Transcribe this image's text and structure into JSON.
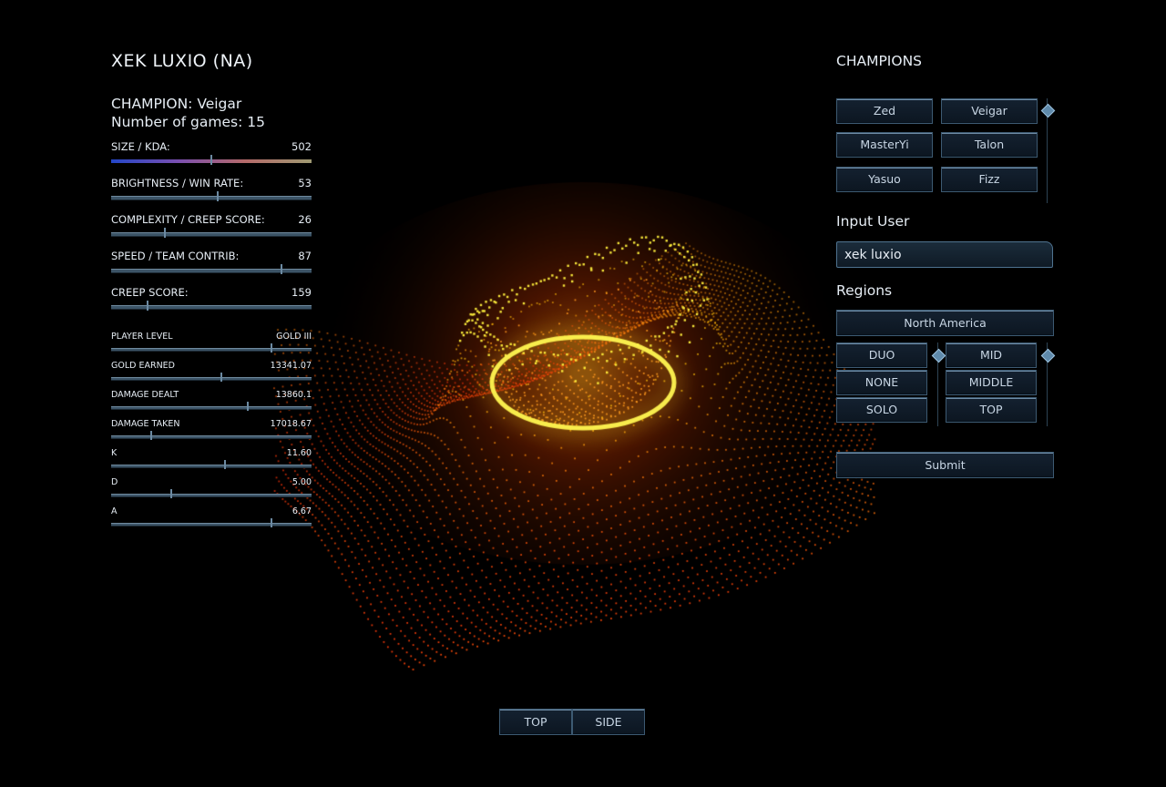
{
  "player": {
    "title": "XEK LUXIO (NA)"
  },
  "champion_info": {
    "champion_line": "CHAMPION: Veigar",
    "games_line": "Number of games: 15"
  },
  "primary_stats": [
    {
      "label": "SIZE / KDA:",
      "value": "502",
      "slider": 0.5
    },
    {
      "label": "BRIGHTNESS / WIN RATE:",
      "value": "53",
      "slider": 0.53
    },
    {
      "label": "COMPLEXITY / CREEP SCORE:",
      "value": "26",
      "slider": 0.27
    },
    {
      "label": "SPEED / TEAM CONTRIB:",
      "value": "87",
      "slider": 0.85
    },
    {
      "label": "CREEP SCORE:",
      "value": "159",
      "slider": 0.18
    }
  ],
  "detail_stats": [
    {
      "label": "PLAYER LEVEL",
      "value": "GOLD III",
      "slider": 0.8
    },
    {
      "label": "GOLD EARNED",
      "value": "13341.07",
      "slider": 0.55
    },
    {
      "label": "DAMAGE DEALT",
      "value": "13860.1",
      "slider": 0.68
    },
    {
      "label": "DAMAGE TAKEN",
      "value": "17018.67",
      "slider": 0.2
    },
    {
      "label": "K",
      "value": "11.60",
      "slider": 0.57
    },
    {
      "label": "D",
      "value": "5.00",
      "slider": 0.3
    },
    {
      "label": "A",
      "value": "6.67",
      "slider": 0.8
    }
  ],
  "champions": {
    "heading": "CHAMPIONS",
    "list": [
      "Zed",
      "Veigar",
      "MasterYi",
      "Talon",
      "Yasuo",
      "Fizz"
    ]
  },
  "input_user": {
    "heading": "Input User",
    "value": "xek luxio"
  },
  "regions": {
    "heading": "Regions",
    "selected": "North America",
    "roles": [
      "DUO",
      "NONE",
      "SOLO"
    ],
    "lanes": [
      "MID",
      "MIDDLE",
      "TOP"
    ]
  },
  "submit_label": "Submit",
  "views": {
    "top_label": "TOP",
    "side_label": "SIDE"
  },
  "colors": {
    "accent": "#3d5a72",
    "glow_core": "#fff23a",
    "glow_outer": "#ff3b00"
  }
}
